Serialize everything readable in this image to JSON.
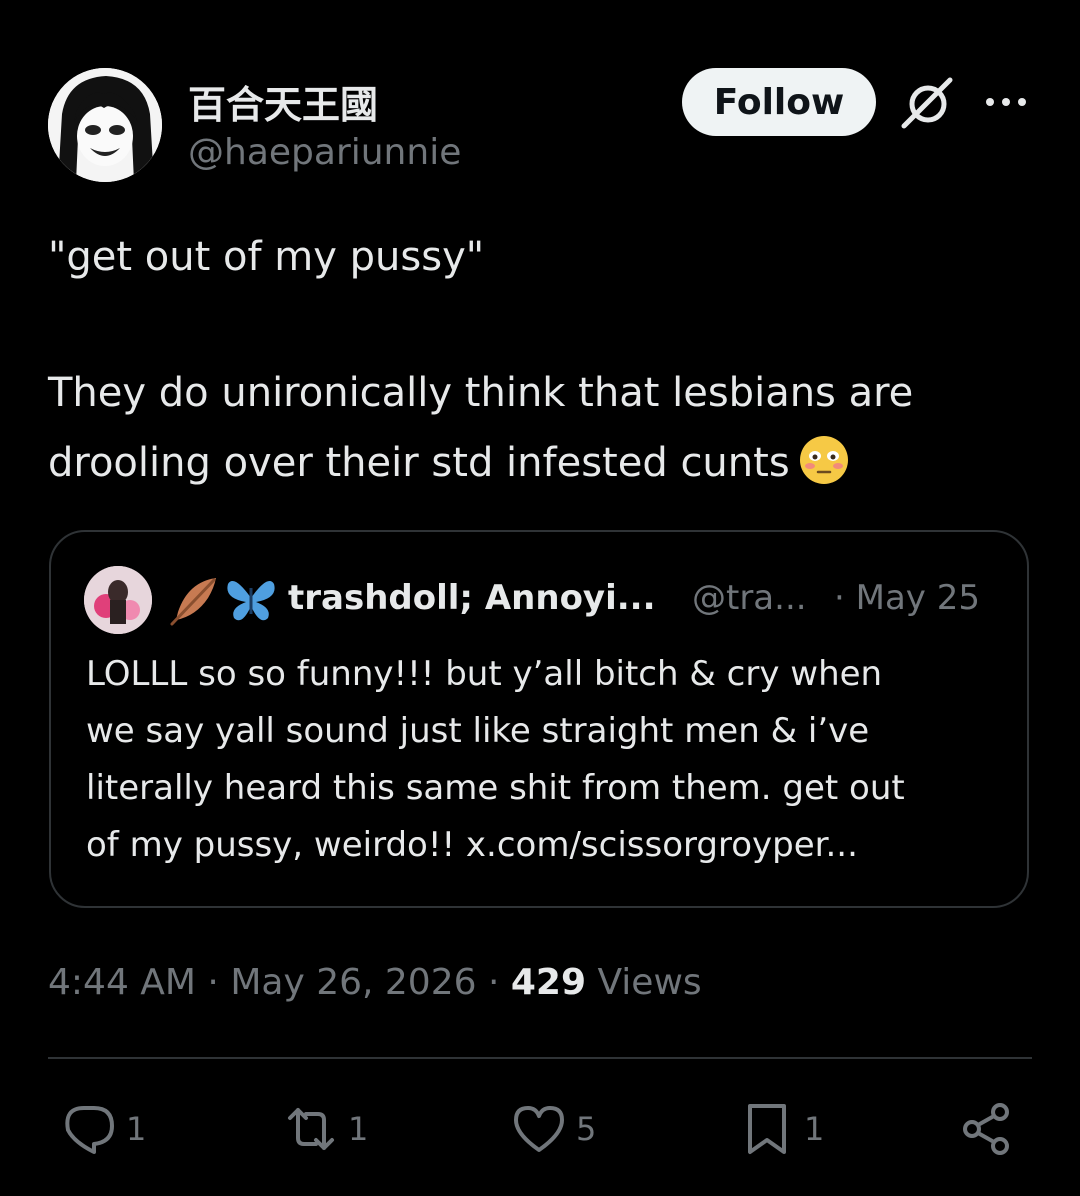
{
  "author": {
    "display_name": "百合天王國",
    "handle": "@haepariunnie",
    "avatar_icon": "anime-character-avatar"
  },
  "header": {
    "follow_label": "Follow",
    "grok_icon": "grok-icon",
    "more_icon": "more-icon"
  },
  "tweet": {
    "line1": "\"get out of my pussy\"",
    "line2": "They do unironically think that lesbians are",
    "line3": "drooling over their std infested cunts",
    "emoji": "flushed-face-emoji"
  },
  "quote": {
    "name": "trashdoll; Annoyi...",
    "handle": "@tra...",
    "date": "· May 25",
    "emojis": [
      "feather-icon",
      "butterfly-icon"
    ],
    "lines": [
      "LOLLL so so funny!!! but y’all bitch & cry when",
      "we say yall sound just like straight men & i’ve",
      "literally heard this same shit from them. get out",
      "of my pussy, weirdo!! x.com/scissorgroyper..."
    ]
  },
  "meta": {
    "time": "4:44 AM",
    "sep1": " · ",
    "date": "May 26, 2026",
    "sep2": " · ",
    "views_count": "429",
    "views_label": " Views"
  },
  "actions": {
    "reply_count": "1",
    "repost_count": "1",
    "like_count": "5",
    "bookmark_count": "1"
  },
  "colors": {
    "background": "#000000",
    "text": "#e7e9ea",
    "secondary": "#71767b",
    "border": "#2f3336",
    "follow_bg": "#eff3f4"
  }
}
